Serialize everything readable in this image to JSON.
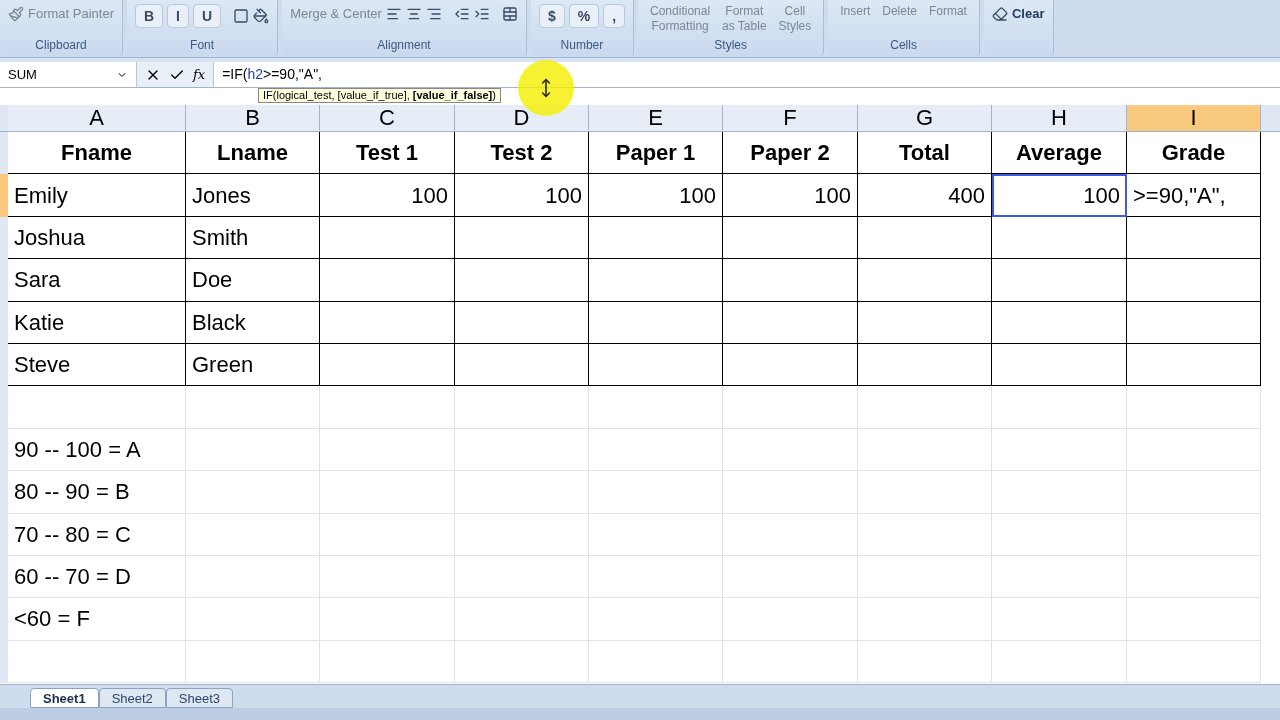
{
  "ribbon": {
    "groups": [
      {
        "label": "Clipboard",
        "buttons": [
          "Format Painter"
        ]
      },
      {
        "label": "Font",
        "glyphs": [
          "B",
          "I",
          "U"
        ]
      },
      {
        "label": "Alignment",
        "buttons": [
          "Merge & Center"
        ]
      },
      {
        "label": "Number",
        "glyphs": [
          "$",
          "%",
          ","
        ]
      },
      {
        "label": "Styles",
        "stacked": [
          [
            "Conditional",
            "Formatting"
          ],
          [
            "Format",
            "as Table"
          ],
          [
            "Cell",
            "Styles"
          ]
        ]
      },
      {
        "label": "Cells",
        "stacked": [
          [
            "Insert"
          ],
          [
            "Delete"
          ],
          [
            "Format"
          ]
        ]
      },
      {
        "buttons": [
          "Clear"
        ]
      }
    ]
  },
  "formula_bar": {
    "name_box": "SUM",
    "function_label": "fx",
    "formula": [
      {
        "kind": "plain",
        "text": "=IF("
      },
      {
        "kind": "reference",
        "text": "h2"
      },
      {
        "kind": "plain",
        "text": ">=90,\"A\","
      }
    ],
    "tooltip": "IF(logical_test, [value_if_true], **[value_if_false]**)"
  },
  "sheet": {
    "columns": [
      {
        "letter": "A",
        "referenced": false,
        "selected": false
      },
      {
        "letter": "B",
        "referenced": false,
        "selected": false
      },
      {
        "letter": "C",
        "referenced": false,
        "selected": false
      },
      {
        "letter": "D",
        "referenced": false,
        "selected": false
      },
      {
        "letter": "E",
        "referenced": false,
        "selected": false
      },
      {
        "letter": "F",
        "referenced": false,
        "selected": false
      },
      {
        "letter": "G",
        "referenced": false,
        "selected": false
      },
      {
        "letter": "H",
        "referenced": true,
        "selected": false
      },
      {
        "letter": "I",
        "referenced": false,
        "selected": true
      }
    ],
    "header_row": [
      "Fname",
      "Lname",
      "Test 1",
      "Test 2",
      "Paper 1",
      "Paper 2",
      "Total",
      "Average",
      "Grade"
    ],
    "rows": [
      {
        "selected": true,
        "cells": [
          "Emily",
          "Jones",
          "100",
          "100",
          "100",
          "100",
          "400",
          "100",
          ">=90,\"A\","
        ]
      },
      {
        "selected": false,
        "cells": [
          "Joshua",
          "Smith"
        ]
      },
      {
        "selected": false,
        "cells": [
          "Sara",
          "Doe"
        ]
      },
      {
        "selected": false,
        "cells": [
          "Katie",
          "Black"
        ]
      },
      {
        "selected": false,
        "cells": [
          "Steve",
          "Green"
        ]
      }
    ],
    "notes": [
      "90 -- 100 = A",
      "80 -- 90 = B",
      "70 -- 80 = C",
      "60 -- 70 = D",
      "<60 = F"
    ]
  },
  "sheet_tabs": [
    {
      "label": "Sheet1",
      "selected": true
    },
    {
      "label": "Sheet2",
      "selected": false
    },
    {
      "label": "Sheet3",
      "selected": false
    }
  ]
}
